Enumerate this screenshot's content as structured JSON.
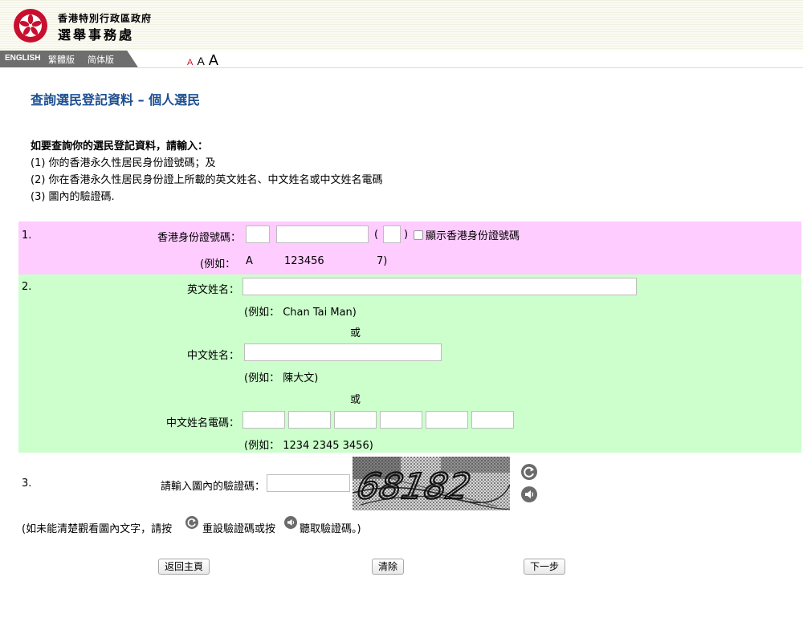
{
  "header": {
    "gov_name": "香港特別行政區政府",
    "dept_name": "選舉事務處",
    "languages": [
      "ENGLISH",
      "繁體版",
      "简体版"
    ],
    "font_sizes": [
      "A",
      "A",
      "A"
    ]
  },
  "page_title": "查詢選民登記資料 – 個人選民",
  "intro": {
    "lead": "如要查詢你的選民登記資料，請輸入：",
    "items": [
      "(1) 你的香港永久性居民身份證號碼；及",
      "(2) 你在香港永久性居民身份證上所載的英文姓名、中文姓名或中文姓名電碼",
      "(3) 圖內的驗證碼."
    ]
  },
  "section1": {
    "number": "1.",
    "label": "香港身份證號碼：",
    "open_paren": "(",
    "close_paren": ")",
    "checkbox_label": "顯示香港身份證號碼",
    "example_prefix": "(例如：",
    "example_letter": "A",
    "example_digits": "123456",
    "example_check": "7)"
  },
  "section2": {
    "number": "2.",
    "english_label": "英文姓名：",
    "english_example": "(例如： Chan Tai Man)",
    "or": "或",
    "chinese_label": "中文姓名：",
    "chinese_example": "(例如： 陳大文)",
    "code_label": "中文姓名電碼：",
    "code_example": "(例如： 1234 2345 3456)"
  },
  "section3": {
    "number": "3.",
    "label": "請輸入圖內的驗證碼：",
    "captcha_text": "68182"
  },
  "help": {
    "part1": "(如未能清楚觀看圖內文字，請按",
    "part2": "重設驗證碼或按",
    "part3": "聽取驗證碼。)"
  },
  "buttons": {
    "home": "返回主頁",
    "clear": "清除",
    "next": "下一步"
  },
  "colors": {
    "title_blue": "#1d4f91",
    "section1_bg": "#ffccff",
    "section2_bg": "#ccffcc",
    "logo_red": "#c8102e"
  }
}
